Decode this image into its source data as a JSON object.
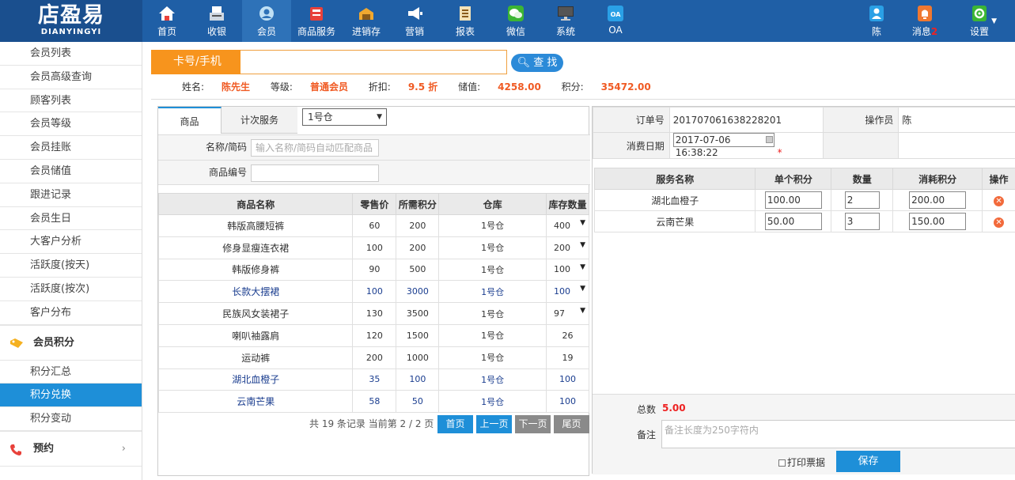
{
  "brand": {
    "name": "店盈易",
    "sub": "DIANYINGYI"
  },
  "nav": [
    {
      "label": "首页",
      "icon": "home-icon"
    },
    {
      "label": "收银",
      "icon": "cashier-icon"
    },
    {
      "label": "会员",
      "icon": "member-icon"
    },
    {
      "label": "商品服务",
      "icon": "goods-icon"
    },
    {
      "label": "进销存",
      "icon": "inventory-icon"
    },
    {
      "label": "营销",
      "icon": "megaphone-icon"
    },
    {
      "label": "报表",
      "icon": "report-icon"
    },
    {
      "label": "微信",
      "icon": "wechat-icon"
    },
    {
      "label": "系统",
      "icon": "monitor-icon"
    },
    {
      "label": "OA",
      "icon": "oa-icon"
    }
  ],
  "user": {
    "name": "陈",
    "messages_label": "消息",
    "messages_count": "2",
    "settings_label": "设置"
  },
  "sidebar": {
    "items": [
      "会员列表",
      "会员高级查询",
      "顾客列表",
      "会员等级",
      "会员挂账",
      "会员储值",
      "跟进记录",
      "会员生日",
      "大客户分析",
      "活跃度(按天)",
      "活跃度(按次)",
      "客户分布"
    ],
    "group1": "会员积分",
    "group1_items": [
      "积分汇总",
      "积分兑换",
      "积分变动"
    ],
    "group2": "预约"
  },
  "search": {
    "label": "卡号/手机",
    "value": "",
    "button": "查 找"
  },
  "member": {
    "name_label": "姓名:",
    "name": "陈先生",
    "level_label": "等级:",
    "level": "普通会员",
    "discount_label": "折扣:",
    "discount": "9.5 折",
    "balance_label": "储值:",
    "balance": "4258.00",
    "points_label": "积分:",
    "points": "35472.00"
  },
  "tabs": {
    "goods": "商品",
    "service": "计次服务",
    "warehouse": "1号仓"
  },
  "filters": {
    "name_label": "名称/简码",
    "name_placeholder": "输入名称/简码自动匹配商品",
    "code_label": "商品编号",
    "code_placeholder": ""
  },
  "goods_table": {
    "headers": [
      "商品名称",
      "零售价",
      "所需积分",
      "仓库",
      "库存数量"
    ],
    "rows": [
      {
        "name": "韩版高腰短裤",
        "price": "60",
        "points": "200",
        "wh": "1号仓",
        "stock": "400",
        "dropdown": true,
        "highlight": false
      },
      {
        "name": "修身显瘦连衣裙",
        "price": "100",
        "points": "200",
        "wh": "1号仓",
        "stock": "200",
        "dropdown": true,
        "highlight": false
      },
      {
        "name": "韩版修身裤",
        "price": "90",
        "points": "500",
        "wh": "1号仓",
        "stock": "100",
        "dropdown": true,
        "highlight": false
      },
      {
        "name": "长款大摆裙",
        "price": "100",
        "points": "3000",
        "wh": "1号仓",
        "stock": "100",
        "dropdown": true,
        "highlight": true
      },
      {
        "name": "民族风女装裙子",
        "price": "130",
        "points": "3500",
        "wh": "1号仓",
        "stock": "97",
        "dropdown": true,
        "highlight": false
      },
      {
        "name": "喇叭袖露肩",
        "price": "120",
        "points": "1500",
        "wh": "1号仓",
        "stock": "26",
        "dropdown": false,
        "highlight": false
      },
      {
        "name": "运动裤",
        "price": "200",
        "points": "1000",
        "wh": "1号仓",
        "stock": "19",
        "dropdown": false,
        "highlight": false
      },
      {
        "name": "湖北血橙子",
        "price": "35",
        "points": "100",
        "wh": "1号仓",
        "stock": "100",
        "dropdown": false,
        "highlight": true
      },
      {
        "name": "云南芒果",
        "price": "58",
        "points": "50",
        "wh": "1号仓",
        "stock": "100",
        "dropdown": false,
        "highlight": true
      }
    ]
  },
  "pager": {
    "text": "共 19 条记录 当前第 2 / 2 页",
    "first": "首页",
    "prev": "上一页",
    "next": "下一页",
    "last": "尾页"
  },
  "order": {
    "order_no_label": "订单号",
    "order_no": "201707061638228201",
    "operator_label": "操作员",
    "operator": "陈",
    "date_label": "消费日期",
    "date": "2017-07-06 16:38:22",
    "required_mark": "*"
  },
  "service_table": {
    "headers": [
      "服务名称",
      "单个积分",
      "数量",
      "消耗积分",
      "操作"
    ],
    "rows": [
      {
        "name": "湖北血橙子",
        "unit_points": "100.00",
        "qty": "2",
        "total": "200.00"
      },
      {
        "name": "云南芒果",
        "unit_points": "50.00",
        "qty": "3",
        "total": "150.00"
      }
    ]
  },
  "footer": {
    "total_label": "总数",
    "total": "5.00",
    "notes_label": "备注",
    "notes_placeholder": "备注长度为250字符内",
    "print_label": "打印票据",
    "save": "保存"
  },
  "colors": {
    "topbar": "#1f5fa6",
    "accent_orange": "#f7941d",
    "primary_blue": "#1e8fd8",
    "highlight_text": "#f05a23"
  }
}
